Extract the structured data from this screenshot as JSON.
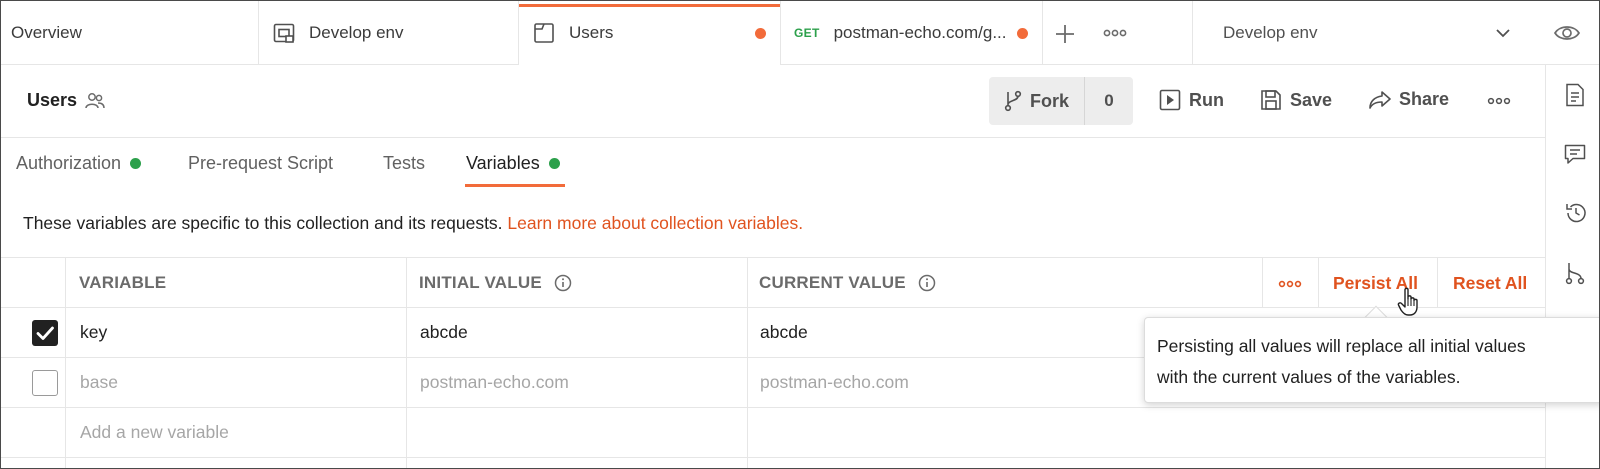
{
  "tabs": [
    {
      "label": "Overview"
    },
    {
      "label": "Develop env",
      "icon": "environment-icon"
    },
    {
      "label": "Users",
      "icon": "collection-icon",
      "unsaved": true
    },
    {
      "method": "GET",
      "label": "postman-echo.com/g...",
      "unsaved": true
    }
  ],
  "environment": {
    "selected": "Develop env"
  },
  "header": {
    "title": "Users",
    "fork_label": "Fork",
    "fork_count": "0",
    "run_label": "Run",
    "save_label": "Save",
    "share_label": "Share"
  },
  "subtabs": [
    {
      "label": "Authorization",
      "indicator": true
    },
    {
      "label": "Pre-request Script"
    },
    {
      "label": "Tests"
    },
    {
      "label": "Variables",
      "indicator": true,
      "active": true
    }
  ],
  "info": {
    "text": "These variables are specific to this collection and its requests. ",
    "link": "Learn more about collection variables."
  },
  "table": {
    "headers": {
      "variable": "VARIABLE",
      "initial": "INITIAL VALUE",
      "current": "CURRENT VALUE"
    },
    "persist_all": "Persist All",
    "reset_all": "Reset All",
    "rows": [
      {
        "checked": true,
        "variable": "key",
        "initial": "abcde",
        "current": "abcde"
      },
      {
        "checked": false,
        "variable": "base",
        "initial": "postman-echo.com",
        "current": "postman-echo.com"
      }
    ],
    "add_placeholder": "Add a new variable"
  },
  "tooltip": {
    "line1": "Persisting all values will replace all initial values",
    "line2": "with the current values of the variables."
  },
  "colors": {
    "accent": "#f26b3a",
    "link": "#e0531f",
    "success": "#2ca04b"
  }
}
